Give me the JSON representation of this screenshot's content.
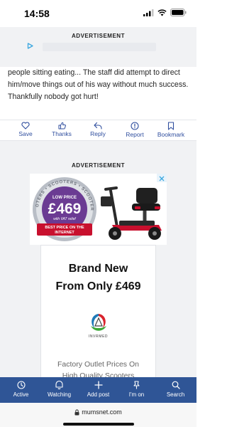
{
  "status": {
    "time": "14:58"
  },
  "ads": {
    "top_label": "ADVERTISEMENT",
    "main_label": "ADVERTISEMENT"
  },
  "post": {
    "text": "people sitting eating... The staff did attempt to direct him/move things out of his way without much success. Thankfully nobody got hurt!"
  },
  "actions": [
    {
      "label": "Save",
      "icon": "heart-icon"
    },
    {
      "label": "Thanks",
      "icon": "thanks-icon"
    },
    {
      "label": "Reply",
      "icon": "reply-icon"
    },
    {
      "label": "Report",
      "icon": "report-icon"
    },
    {
      "label": "Bookmark",
      "icon": "bookmark-icon"
    }
  ],
  "banner": {
    "arc_text": "SCOOTERS • SCOOTERS • SCOOTERS •",
    "badge_top": "LOW PRICE",
    "price": "£469",
    "vat": "with VAT relief",
    "ribbon_1": "BEST PRICE ON THE",
    "ribbon_2": "INTERNET"
  },
  "card": {
    "headline_1": "Brand New",
    "headline_2": "From Only £469",
    "logo_text": "INVRMED",
    "tagline_1": "Factory Outlet Prices On",
    "tagline_2": "High Quality Scooters"
  },
  "tabs": [
    {
      "label": "Active",
      "icon": "clock-icon"
    },
    {
      "label": "Watching",
      "icon": "watching-icon"
    },
    {
      "label": "Add post",
      "icon": "plus-icon"
    },
    {
      "label": "I'm on",
      "icon": "pin-icon"
    },
    {
      "label": "Search",
      "icon": "search-icon"
    }
  ],
  "browser": {
    "url": "mumsnet.com"
  },
  "colors": {
    "brand_blue": "#2f5596",
    "action_blue": "#2f4e9e",
    "badge_purple": "#6b3b93",
    "ribbon_red": "#c8102e"
  }
}
